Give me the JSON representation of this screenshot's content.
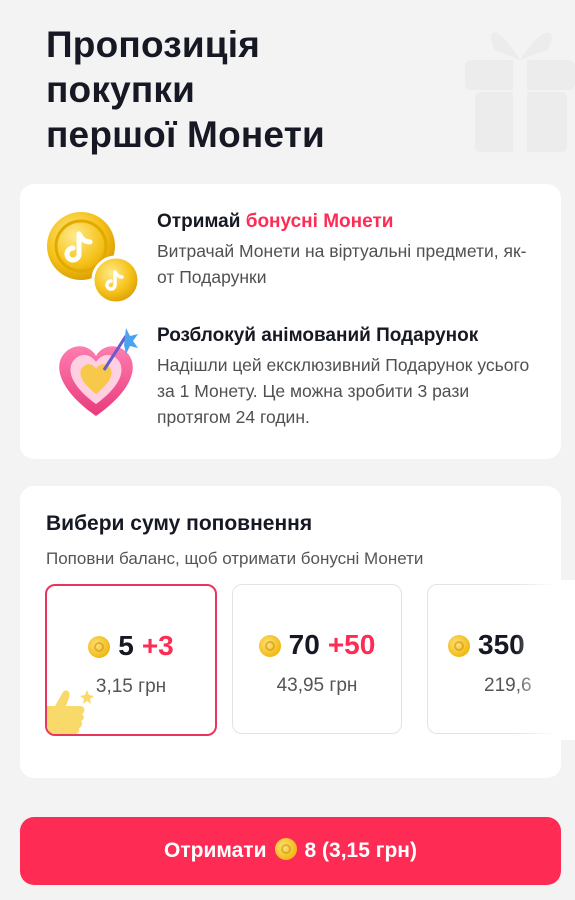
{
  "header": {
    "title_lines": [
      "Пропозиція",
      "покупки",
      "першої Монети"
    ]
  },
  "benefits": [
    {
      "icon": "coins-icon",
      "title_prefix": "Отримай ",
      "title_accent": "бонусні Монети",
      "description": "Витрачай Монети на віртуальні предмети, як-от Подарунки"
    },
    {
      "icon": "heart-gift-icon",
      "title_prefix": "Розблокуй анімований Подарунок",
      "title_accent": "",
      "description": "Надішли цей ексклюзивний Подарунок усього за 1 Монету. Це можна зробити 3 рази протягом 24 годин."
    }
  ],
  "recharge": {
    "title": "Вибери суму поповнення",
    "subtitle": "Поповни баланс, щоб отримати бонусні Монети",
    "packages": [
      {
        "coins": "5",
        "bonus": "+3",
        "price": "3,15 грн",
        "selected": true
      },
      {
        "coins": "70",
        "bonus": "+50",
        "price": "43,95 грн",
        "selected": false
      },
      {
        "coins": "350",
        "bonus": "",
        "price": "219,6",
        "selected": false
      }
    ]
  },
  "cta": {
    "prefix": "Отримати",
    "suffix": "8 (3,15 грн)"
  },
  "colors": {
    "accent": "#fe2c55",
    "selected_border": "#e8355b",
    "background": "#f3f3f4",
    "coin": "#f0b913"
  }
}
